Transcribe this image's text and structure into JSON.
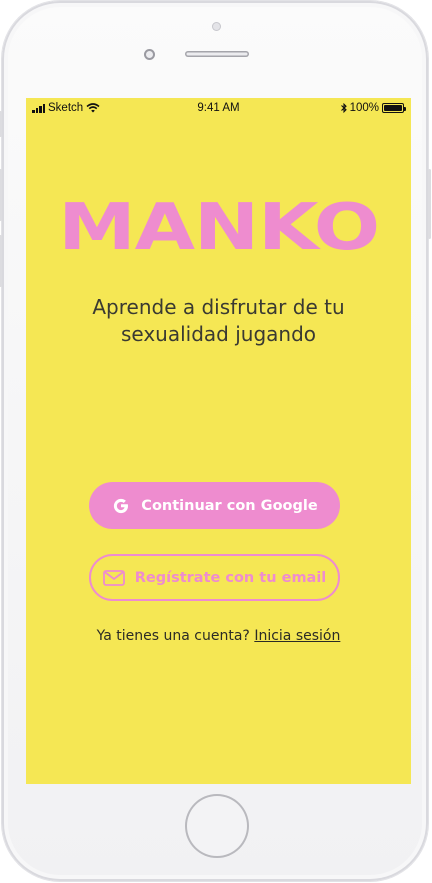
{
  "status_bar": {
    "carrier": "Sketch",
    "time": "9:41 AM",
    "battery": "100%",
    "battery_level": 1.0
  },
  "app": {
    "logo": "MANKO",
    "tagline_line1": "Aprende a disfrutar de tu",
    "tagline_line2": "sexualidad jugando"
  },
  "actions": {
    "google_label": "Continuar con Google",
    "email_label": "Regístrate con tu email"
  },
  "login": {
    "prompt": "Ya tienes una cuenta?",
    "link": "Inicia sesión"
  },
  "colors": {
    "background": "#f5e754",
    "accent": "#ee8ccf",
    "text": "#3a3a32"
  },
  "icons": {
    "google": "google-icon",
    "email": "mail-icon",
    "wifi": "wifi-icon",
    "bluetooth": "bluetooth-icon",
    "battery": "battery-icon",
    "signal": "signal-icon"
  }
}
